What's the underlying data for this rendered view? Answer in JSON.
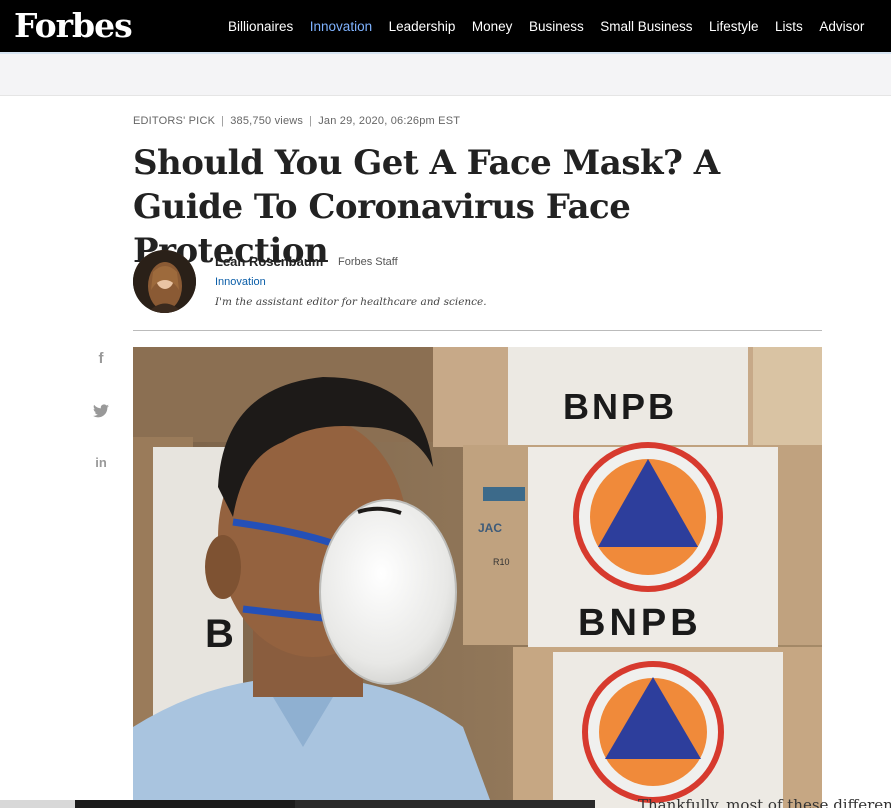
{
  "brand": {
    "logo": "Forbes"
  },
  "nav": {
    "items": [
      {
        "label": "Billionaires"
      },
      {
        "label": "Innovation"
      },
      {
        "label": "Leadership"
      },
      {
        "label": "Money"
      },
      {
        "label": "Business"
      },
      {
        "label": "Small Business"
      },
      {
        "label": "Lifestyle"
      },
      {
        "label": "Lists"
      },
      {
        "label": "Advisor"
      }
    ],
    "active": "Innovation"
  },
  "article": {
    "kicker": "EDITORS' PICK",
    "views": "385,750 views",
    "date": "Jan 29, 2020, 06:26pm EST",
    "headline": "Should You Get A Face Mask? A Guide To Coronavirus Face Protection",
    "author": {
      "name": "Leah Rosenbaum",
      "role": "Forbes Staff",
      "category": "Innovation",
      "bio": "I'm the assistant editor for healthcare and science."
    },
    "share": {
      "facebook_icon": "f",
      "linkedin_icon": "in"
    },
    "image": {
      "box_text_1": "BNPB",
      "box_text_2": "BNPB",
      "box_text_3": "B",
      "box_text_4": "JAC",
      "box_text_5": "R10"
    },
    "body_preview": "Thankfully, most of these differences"
  },
  "colors": {
    "nav_bg": "#000000",
    "nav_active": "#7fb3ff",
    "link_blue": "#0b5ea8"
  }
}
